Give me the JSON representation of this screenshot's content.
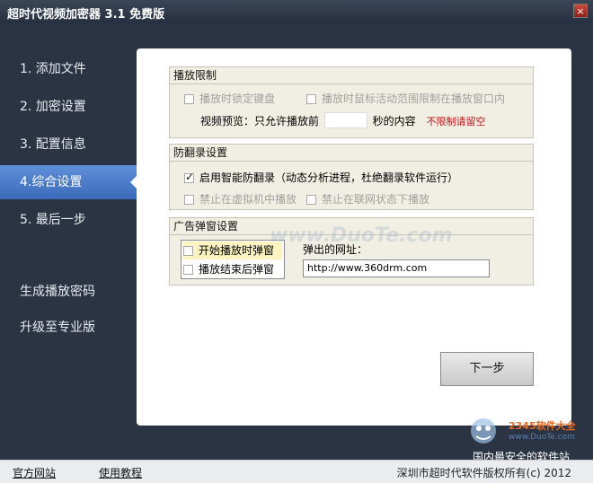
{
  "window": {
    "title": "超时代视频加密器 3.1 免费版",
    "close_label": "×"
  },
  "sidebar": {
    "items": [
      {
        "label": "1. 添加文件"
      },
      {
        "label": "2. 加密设置"
      },
      {
        "label": "3. 配置信息"
      },
      {
        "label": "4.综合设置"
      },
      {
        "label": "5. 最后一步"
      },
      {
        "label": "生成播放密码"
      },
      {
        "label": "升级至专业版"
      }
    ]
  },
  "playback_limit": {
    "title": "播放限制",
    "lock_keyboard": "播放时锁定键盘",
    "limit_mouse": "播放时鼠标活动范围限制在播放窗口内",
    "preview_prefix": "视频预览：只允许播放前",
    "preview_seconds": "",
    "preview_suffix": "秒的内容",
    "preview_note": "不限制请留空"
  },
  "anti_record": {
    "title": "防翻录设置",
    "smart_anti": "启用智能防翻录（动态分析进程，杜绝翻录软件运行）",
    "no_vm": "禁止在虚拟机中播放",
    "no_network": "禁止在联网状态下播放"
  },
  "ad_popup": {
    "title": "广告弹窗设置",
    "popup_on_start": "开始播放时弹窗",
    "popup_on_end": "播放结束后弹窗",
    "url_label": "弹出的网址：",
    "url_value": "http://www.360drm.com"
  },
  "buttons": {
    "next": "下一步"
  },
  "footer": {
    "official_site": "官方网站",
    "tutorial": "使用教程",
    "copyright": "深圳市超时代软件版权所有(c) 2012"
  },
  "watermark": {
    "site": "www.DuoTe.com",
    "badge": "2345软件大全",
    "badge_url": "www.DuoTe.com",
    "tagline": "国内最安全的软件站"
  },
  "colors": {
    "sidebar_bg": "#2b3442",
    "active_nav": "#4a7bc8",
    "note_red": "#b8161c"
  }
}
